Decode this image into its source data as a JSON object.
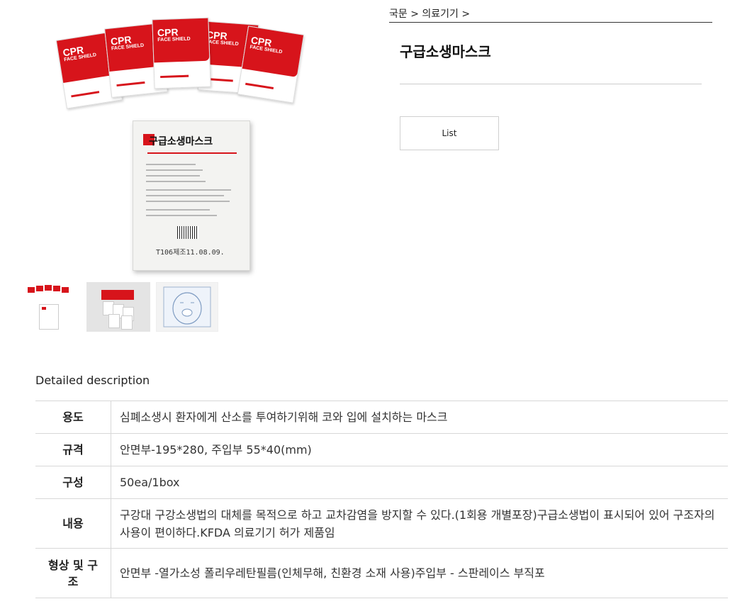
{
  "breadcrumb": {
    "root": "국문",
    "category": "의료기기",
    "sep": ">"
  },
  "product": {
    "title": "구급소생마스크"
  },
  "actions": {
    "list_label": "List"
  },
  "images": {
    "packet_title": "CPR",
    "packet_subtitle": "FACE SHIELD",
    "pouch_title": "구급소생마스크",
    "pouch_code": "T106제조11.08.09."
  },
  "description": {
    "heading": "Detailed description",
    "rows": [
      {
        "label": "용도",
        "value": "심폐소생시 환자에게 산소를 투여하기위해 코와 입에 설치하는 마스크"
      },
      {
        "label": "규격",
        "value": "안면부-195*280, 주입부 55*40(mm)"
      },
      {
        "label": "구성",
        "value": "50ea/1box"
      },
      {
        "label": "내용",
        "value": "구강대 구강소생법의 대체를 목적으로 하고 교차감염을 방지할 수 있다.(1회용 개별포장)구급소생법이 표시되어 있어 구조자의 사용이 편이하다.KFDA 의료기기 허가 제품임"
      },
      {
        "label": "형상 및 구조",
        "value": "안면부 -열가소성 폴리우레탄필름(인체무해, 친환경 소재 사용)주입부 - 스판레이스 부직포"
      }
    ]
  },
  "colors": {
    "brand_red": "#d7141b",
    "text": "#222222",
    "border": "#d8d8d8"
  }
}
